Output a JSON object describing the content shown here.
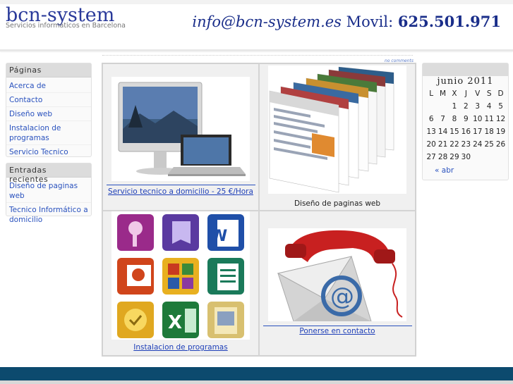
{
  "header": {
    "logo": "bcn-system",
    "slogan": "Servicios informaticos en Barcelona",
    "email": "info@bcn-system.es",
    "movil_label": "Movil:",
    "phone": "625.501.971"
  },
  "post": {
    "comments_link": "no comments"
  },
  "sidebar": {
    "pages_title": "Páginas",
    "pages": [
      "Acerca de",
      "Contacto",
      "Diseño web",
      "Instalacion de programas",
      "Servicio Tecnico"
    ],
    "recent_title": "Entradas recientes",
    "recent": [
      "Diseño de paginas web",
      "Tecnico Informático a domicilio"
    ]
  },
  "grid": {
    "cells": [
      {
        "caption": "Servicio tecnico a domicilio - 25 €/Hora",
        "icon": "computer-icon"
      },
      {
        "caption": "Diseño de paginas web",
        "icon": "web-pages-icon"
      },
      {
        "caption": "Instalacion de programas",
        "icon": "office-programs-icon"
      },
      {
        "caption": "Ponerse en contacto",
        "icon": "phone-mail-icon"
      }
    ]
  },
  "calendar": {
    "month": "junio 2011",
    "weekdays": [
      "L",
      "M",
      "X",
      "J",
      "V",
      "S",
      "D"
    ],
    "weeks": [
      [
        "",
        "",
        "1",
        "2",
        "3",
        "4",
        "5"
      ],
      [
        "6",
        "7",
        "8",
        "9",
        "10",
        "11",
        "12"
      ],
      [
        "13",
        "14",
        "15",
        "16",
        "17",
        "18",
        "19"
      ],
      [
        "20",
        "21",
        "22",
        "23",
        "24",
        "25",
        "26"
      ],
      [
        "27",
        "28",
        "29",
        "30",
        "",
        "",
        ""
      ]
    ],
    "prev_link": "« abr"
  },
  "colors": {
    "link": "#2a52be",
    "brand": "#1a2e8a",
    "footer": "#0c4a6e"
  }
}
